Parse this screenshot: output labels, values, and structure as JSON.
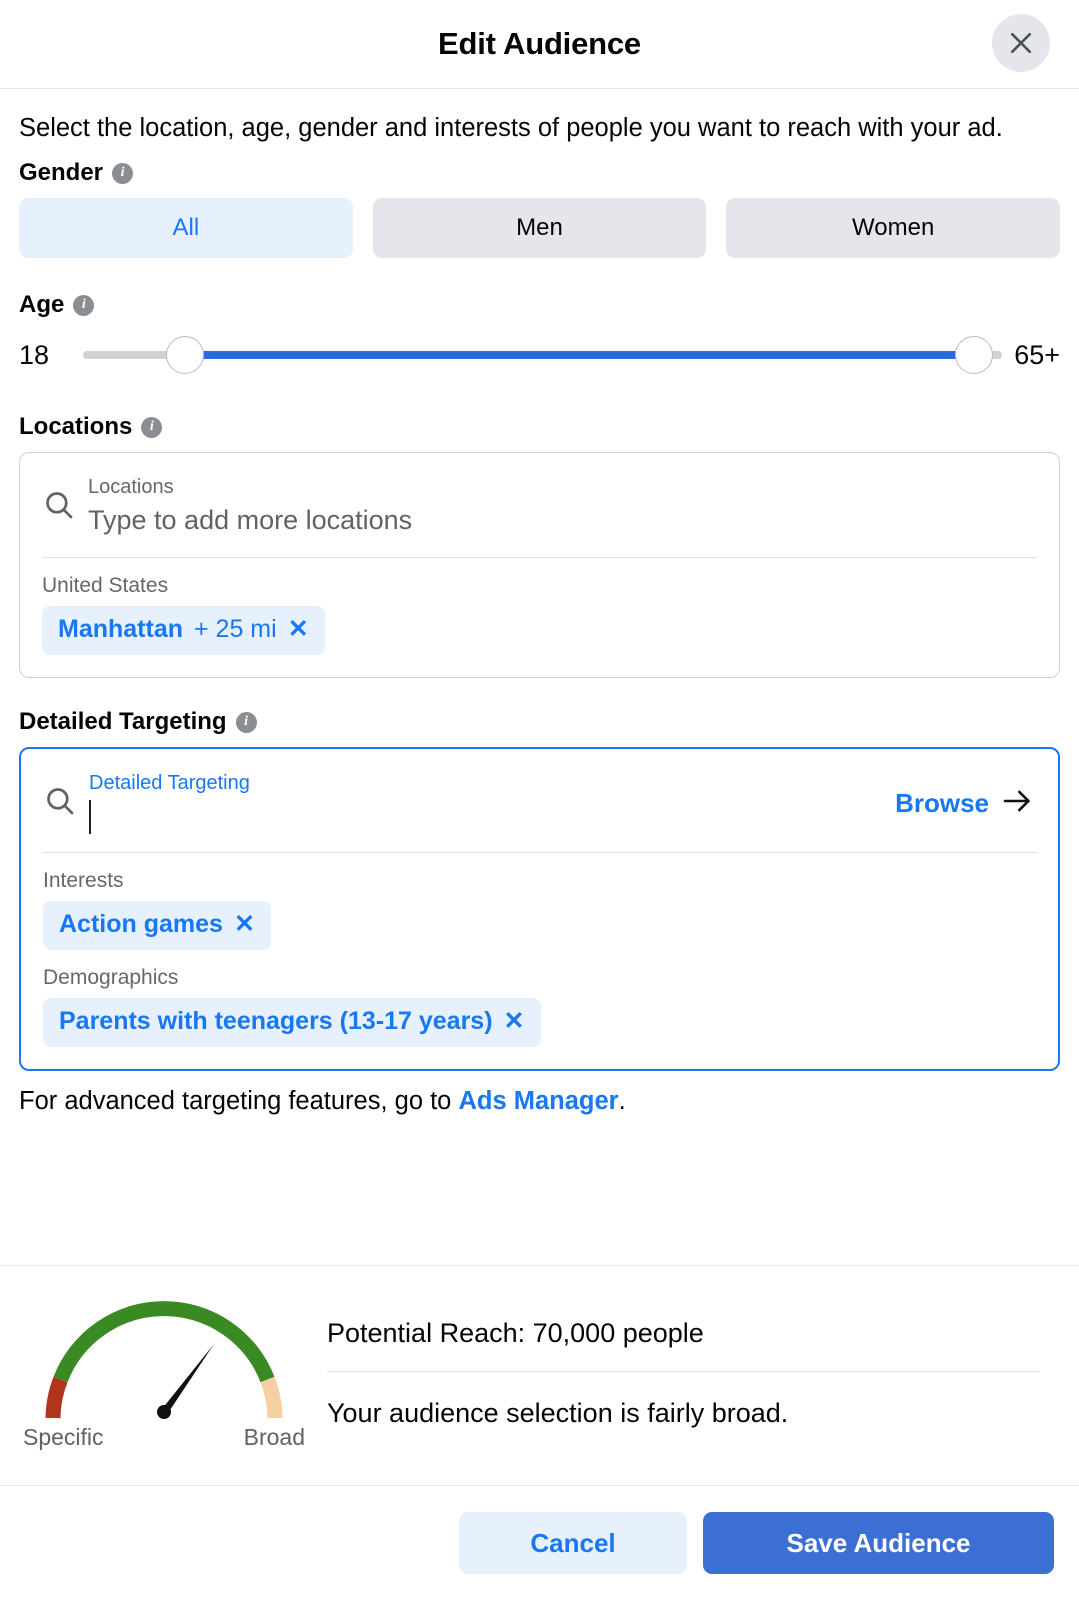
{
  "header": {
    "title": "Edit Audience",
    "close_icon": "close-icon"
  },
  "intro": "Select the location, age, gender and interests of people you want to reach with your ad.",
  "gender": {
    "label": "Gender",
    "info_icon": "info-icon",
    "options": [
      {
        "label": "All",
        "selected": true
      },
      {
        "label": "Men",
        "selected": false
      },
      {
        "label": "Women",
        "selected": false
      }
    ]
  },
  "age": {
    "label": "Age",
    "info_icon": "info-icon",
    "min_label": "18",
    "max_label": "65+",
    "min_value": 18,
    "max_value": 65
  },
  "locations": {
    "label": "Locations",
    "info_icon": "info-icon",
    "search_icon": "search-icon",
    "field_label": "Locations",
    "placeholder": "Type to add more locations",
    "country_group": "United States",
    "tags": [
      {
        "name": "Manhattan",
        "extra": "+ 25 mi",
        "remove_icon": "close-icon"
      }
    ]
  },
  "detailed_targeting": {
    "label": "Detailed Targeting",
    "info_icon": "info-icon",
    "search_icon": "search-icon",
    "field_label": "Detailed Targeting",
    "input_value": "",
    "browse_label": "Browse",
    "browse_icon": "arrow-right-icon",
    "groups": [
      {
        "title": "Interests",
        "tags": [
          {
            "name": "Action games",
            "remove_icon": "close-icon"
          }
        ]
      },
      {
        "title": "Demographics",
        "tags": [
          {
            "name": "Parents with teenagers (13-17 years)",
            "remove_icon": "close-icon"
          }
        ]
      }
    ]
  },
  "advanced_note": {
    "prefix": "For advanced targeting features, go to ",
    "link": "Ads Manager",
    "suffix": "."
  },
  "reach": {
    "gauge_icon": "gauge-icon",
    "specific_label": "Specific",
    "broad_label": "Broad",
    "potential_reach": "Potential Reach: 70,000 people",
    "assessment": "Your audience selection is fairly broad.",
    "gauge_needle_fraction": 0.63,
    "colors": {
      "specific": "#b0351c",
      "mid": "#3a8a23",
      "broad": "#f3cfa2",
      "needle": "#111111"
    }
  },
  "footer": {
    "cancel_label": "Cancel",
    "save_label": "Save Audience"
  },
  "theme": {
    "accent": "#1877f2",
    "accent_dark": "#3b6fd4",
    "chip_bg": "#e7f0fd",
    "neutral_bg": "#e4e6eb"
  }
}
